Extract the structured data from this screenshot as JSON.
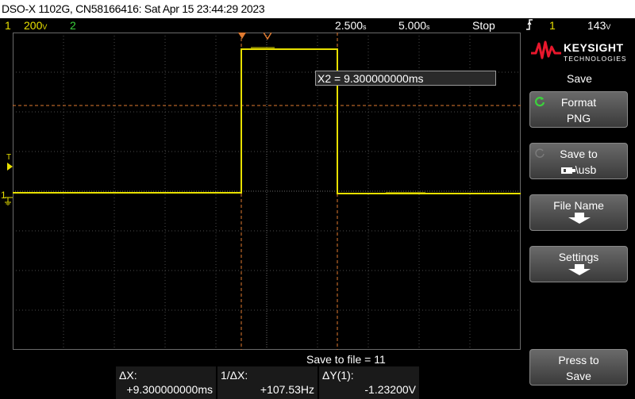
{
  "title_bar": {
    "text": "DSO-X 1102G, CN58166416: Sat Apr 15 23:44:29 2023"
  },
  "status": {
    "ch1_num": "1",
    "ch1_scale": "200",
    "ch1_unit": "V",
    "ch2_num": "2",
    "timebase": "2.500",
    "time_unit": "s",
    "delay": "5.000",
    "delay_unit": "s",
    "run_state": "Stop",
    "trigger_icon": "trigger-edge-icon",
    "trigger_source": "1",
    "trigger_level": "143",
    "trigger_level_unit": "V"
  },
  "screen": {
    "cursor_readout": "X2 = 9.300000000ms",
    "trigger_marker": "T",
    "ch1_marker": "1"
  },
  "panel": {
    "brand_name": "KEYSIGHT",
    "brand_sub": "TECHNOLOGIES",
    "menu_title": "Save",
    "format_label": "Format",
    "format_value": "PNG",
    "saveto_label": "Save to",
    "saveto_value": "\\usb",
    "filename_label": "File Name",
    "settings_label": "Settings",
    "press_label": "Press to",
    "press_value": "Save"
  },
  "bottom": {
    "save_to_file": "Save to file =  11",
    "dx_label": "ΔX:",
    "dx_value": "+9.300000000ms",
    "inv_dx_label": "1/ΔX:",
    "inv_dx_value": "+107.53Hz",
    "dy_label": "ΔY(1):",
    "dy_value": "-1.23200V"
  },
  "colors": {
    "channel1": "#e8e000",
    "channel2": "#3cd23c",
    "cursor": "#e07a30",
    "grid": "#4a4a4a"
  }
}
